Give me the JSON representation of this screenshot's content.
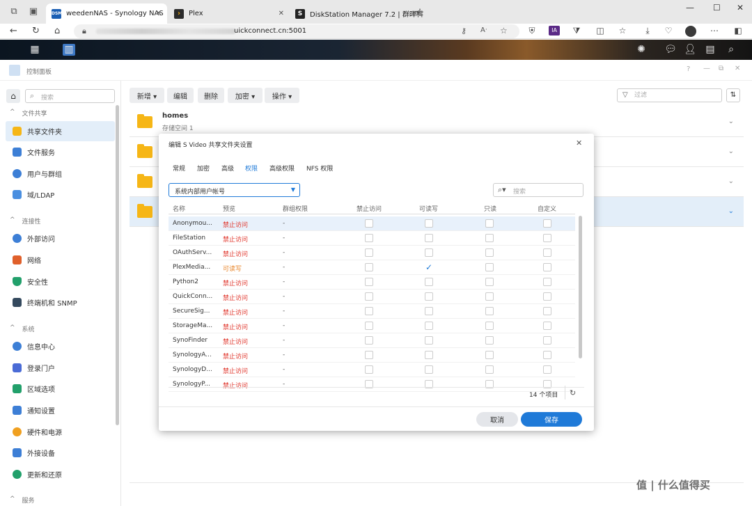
{
  "browser": {
    "tabs": [
      {
        "title": "weedenNAS - Synology NAS",
        "favicon": "DSM"
      },
      {
        "title": "Plex",
        "favicon": "plex-icon"
      },
      {
        "title": "DiskStation Manager 7.2 | 群晖科",
        "favicon": "S"
      }
    ],
    "new_tab": "+",
    "url": "uickconnect.cn:5001"
  },
  "panel": {
    "title": "控制面板"
  },
  "search": {
    "placeholder": "搜索"
  },
  "sidebar": {
    "sections": [
      {
        "label": "文件共享",
        "items": [
          "共享文件夹",
          "文件服务",
          "用户与群组",
          "域/LDAP"
        ]
      },
      {
        "label": "连接性",
        "items": [
          "外部访问",
          "网络",
          "安全性",
          "终端机和 SNMP"
        ]
      },
      {
        "label": "系统",
        "items": [
          "信息中心",
          "登录门户",
          "区域选项",
          "通知设置",
          "硬件和电源",
          "外接设备",
          "更新和还原"
        ]
      },
      {
        "label": "服务",
        "items": []
      }
    ]
  },
  "toolbar": {
    "new": "新增 ▾",
    "edit": "编辑",
    "delete": "删除",
    "encrypt": "加密 ▾",
    "action": "操作 ▾",
    "filter_placeholder": "过滤"
  },
  "folders": [
    {
      "name": "homes",
      "sub": "存储空间 1"
    }
  ],
  "dialog": {
    "title": "编辑 S Video 共享文件夹设置",
    "tabs": [
      "常规",
      "加密",
      "高级",
      "权限",
      "高级权限",
      "NFS 权限"
    ],
    "active_tab": "权限",
    "user_select": "系统内部用户帐号",
    "search_placeholder": "搜索",
    "columns": [
      "名称",
      "预览",
      "群组权限",
      "禁止访问",
      "可读写",
      "只读",
      "自定义"
    ],
    "rows": [
      {
        "name": "Anonymou...",
        "preview": "禁止访问",
        "group": "-",
        "checked": ""
      },
      {
        "name": "FileStation",
        "preview": "禁止访问",
        "group": "-",
        "checked": ""
      },
      {
        "name": "OAuthServ...",
        "preview": "禁止访问",
        "group": "-",
        "checked": ""
      },
      {
        "name": "PlexMedia...",
        "preview": "可读写",
        "group": "-",
        "checked": "rw"
      },
      {
        "name": "Python2",
        "preview": "禁止访问",
        "group": "-",
        "checked": ""
      },
      {
        "name": "QuickConn...",
        "preview": "禁止访问",
        "group": "-",
        "checked": ""
      },
      {
        "name": "SecureSig...",
        "preview": "禁止访问",
        "group": "-",
        "checked": ""
      },
      {
        "name": "StorageMa...",
        "preview": "禁止访问",
        "group": "-",
        "checked": ""
      },
      {
        "name": "SynoFinder",
        "preview": "禁止访问",
        "group": "-",
        "checked": ""
      },
      {
        "name": "SynologyA...",
        "preview": "禁止访问",
        "group": "-",
        "checked": ""
      },
      {
        "name": "SynologyD...",
        "preview": "禁止访问",
        "group": "-",
        "checked": ""
      },
      {
        "name": "SynologyP...",
        "preview": "禁止访问",
        "group": "-",
        "checked": ""
      }
    ],
    "count": "14 个项目",
    "cancel": "取消",
    "ok": "保存"
  },
  "watermark": "值 | 什么值得买",
  "colors": {
    "accent": "#1f7ad8",
    "deny": "#e0352b",
    "rw": "#e8852a"
  }
}
